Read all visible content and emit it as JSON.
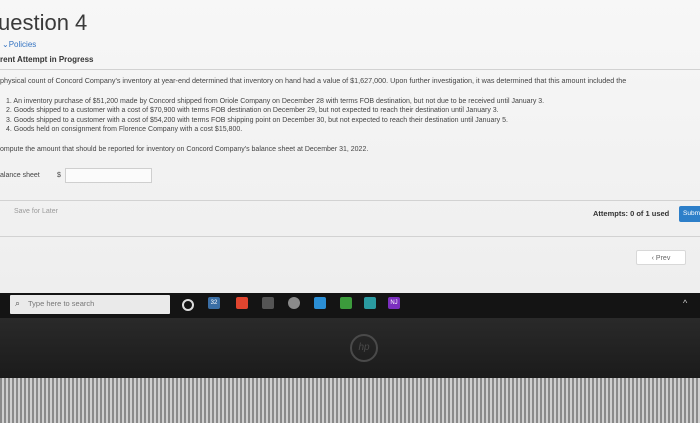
{
  "question": {
    "title": "uestion 4",
    "policies_link": "Policies",
    "attempt_label": "rent Attempt in Progress"
  },
  "problem": {
    "intro": "physical count of Concord Company's inventory at year-end determined that inventory on hand had a value of $1,627,000. Upon further investigation, it was determined that this amount included the",
    "items": [
      "1. An inventory purchase of $51,200 made by Concord shipped from Oriole Company on December 28 with terms FOB destination, but not due to be received until January 3.",
      "2. Goods shipped to a customer with a cost of $70,900 with terms FOB destination on December 29, but not expected to reach their destination until January 3.",
      "3. Goods shipped to a customer with a cost of $54,200 with terms FOB shipping point on December 30, but not expected to reach their destination until January 5.",
      "4. Goods held on consignment from Florence Company with a cost $15,800."
    ],
    "instruction": "ompute the amount that should be reported for inventory on Concord Company's balance sheet at December 31, 2022."
  },
  "answer": {
    "label": "alance sheet",
    "currency": "$",
    "value": ""
  },
  "footer": {
    "save_later": "Save for Later",
    "attempts": "Attempts: 0 of 1 used",
    "submit": "Submit",
    "prev": "‹  Prev"
  },
  "taskbar": {
    "search_placeholder": "Type here to search",
    "icons": [
      "cortana-icon",
      "task-view-icon",
      "app-icon-orange",
      "app-icon-red",
      "app-icon-green",
      "app-icon-blue",
      "app-icon-yellow",
      "app-icon-teal",
      "app-icon-nj"
    ]
  },
  "device": {
    "brand": "hp"
  }
}
